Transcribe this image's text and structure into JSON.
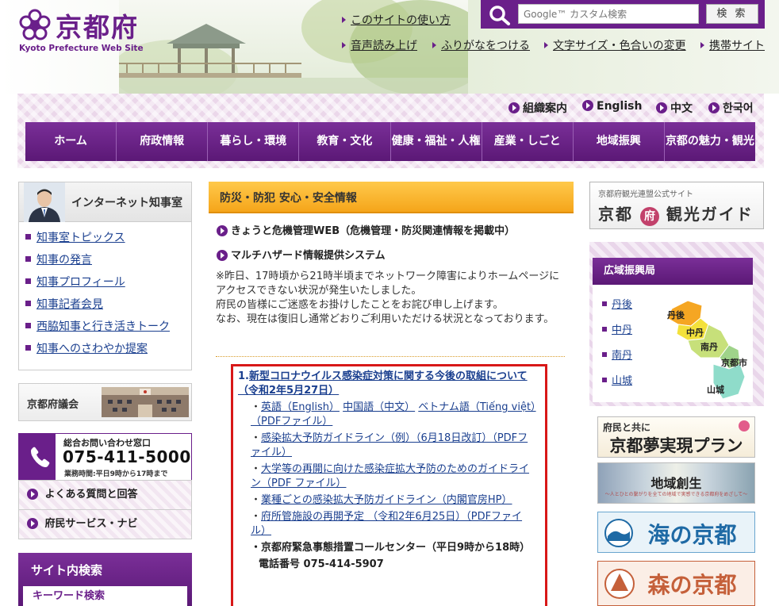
{
  "header": {
    "logo_name": "京都府",
    "logo_sub": "Kyoto Prefecture Web Site",
    "util_links": {
      "howto": "このサイトの使い方",
      "voice": "音声読み上げ",
      "furigana": "ふりがなをつける",
      "textsize": "文字サイズ・色合いの変更",
      "mobile": "携帯サイト"
    },
    "search": {
      "placeholder": "Google™ カスタム検索",
      "button": "検 索"
    }
  },
  "lang_links": [
    "組織案内",
    "English",
    "中文",
    "한국어"
  ],
  "global_nav": [
    "ホーム",
    "府政情報",
    "暮らし・環境",
    "教育・文化",
    "健康・福祉・人権",
    "産業・しごと",
    "地域振興",
    "京都の魅力・観光"
  ],
  "left": {
    "governor": {
      "title": "インターネット知事室",
      "links": [
        "知事室トピックス",
        "知事の発言",
        "知事プロフィール",
        "知事記者会見",
        "西脇知事と行き活きトーク",
        "知事へのさわやか提案"
      ]
    },
    "council": "京都府議会",
    "contact": {
      "label": "総合お問い合わせ窓口",
      "phone": "075-411-5000",
      "hours": "業務時間:平日9時から17時まで"
    },
    "faq": "よくある質問と回答",
    "navi": "府民サービス・ナビ",
    "site_search": {
      "title": "サイト内検索",
      "keyword": "キーワード検索"
    }
  },
  "main": {
    "heading": "防災・防犯 安心・安全情報",
    "link1": "きょうと危機管理WEB（危機管理・防災関連情報を掲載中）",
    "link2": "マルチハザード情報提供システム",
    "notice1": "※昨日、17時頃から21時半頃までネットワーク障害によりホームページにアクセスできない状況が発生いたしました。",
    "notice2": "府民の皆様にご迷惑をお掛けしたことをお詫び申し上げます。",
    "notice3": "なお、現在は復旧し通常どおりご利用いただける状況となっております。",
    "covid": {
      "number": "1.",
      "title": "新型コロナウイルス感染症対策に関する今後の取組について（令和2年5月27日）",
      "lang_en": "英語（English）",
      "lang_zh": "中国語（中文）",
      "lang_vi": "ベトナム語（Tiếng việt）（PDFファイル）",
      "guideline": "感染拡大予防ガイドライン（例）（6月18日改訂）（PDFファイル）",
      "university": "大学等の再開に向けた感染症拡大予防のためのガイドライン（PDF ファイル）",
      "industry": "業種ごとの感染拡大予防ガイドライン（内閣官房HP）",
      "facilities": "府所管施設の再開予定 （令和2年6月25日）（PDFファイル）",
      "callcenter": "京都府緊急事態措置コールセンター（平日9時から18時）",
      "phone": "電話番号 075-414-5907"
    }
  },
  "right": {
    "tourism": {
      "small": "京都府観光連盟公式サイト",
      "main_a": "京都",
      "main_fu": "府",
      "main_b": "観光ガイド"
    },
    "region": {
      "title": "広域振興局",
      "links": [
        "丹後",
        "中丹",
        "南丹",
        "山城"
      ],
      "map_labels": [
        "丹後",
        "中丹",
        "南丹",
        "京都市",
        "山城"
      ]
    },
    "banners": {
      "yume_small": "府民と共に",
      "yume": "京都夢実現プラン",
      "chiiki": "地域創生",
      "chiiki_sub": "〜人とひとの繋がりを全ての地域で実感できる京都府をめざして〜",
      "umi": "海の京都",
      "mori": "森の京都"
    }
  },
  "colors": {
    "brand_purple": "#6a1f8a",
    "heading_orange": "#f5a51a",
    "alert_red": "#d81818",
    "link_blue": "#1a3f8f"
  }
}
